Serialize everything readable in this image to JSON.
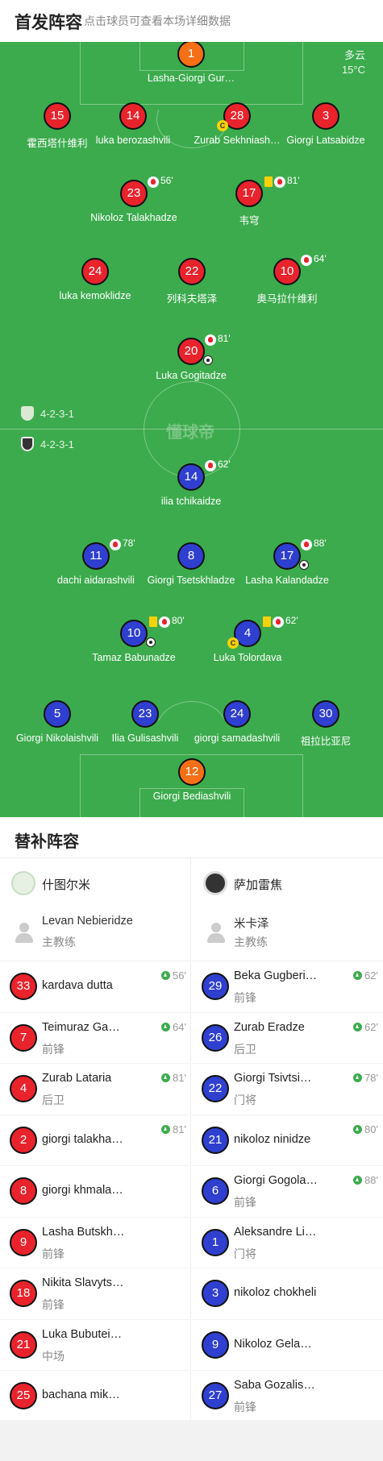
{
  "header": {
    "title": "首发阵容",
    "subtitle": "点击球员可查看本场详细数据"
  },
  "weather": {
    "condition": "多云",
    "temp": "15°C"
  },
  "watermark": "懂球帝",
  "home_formation": "4-2-3-1",
  "away_formation": "4-2-3-1",
  "home": [
    {
      "num": "1",
      "name": "Lasha-Giorgi Gur…",
      "color": "orange"
    },
    {
      "num": "15",
      "name": "霍西塔什维利"
    },
    {
      "num": "14",
      "name": "luka berozashvili"
    },
    {
      "num": "28",
      "name": "Zurab Sekhniash…",
      "captain": "C"
    },
    {
      "num": "3",
      "name": "Giorgi Latsabidze"
    },
    {
      "num": "23",
      "name": "Nikoloz Talakhadze",
      "sub": "56'"
    },
    {
      "num": "17",
      "name": "韦穹",
      "sub": "81'",
      "yellow": true
    },
    {
      "num": "24",
      "name": "luka kemoklidze"
    },
    {
      "num": "22",
      "name": "列科夫塔泽"
    },
    {
      "num": "10",
      "name": "奥马拉什维利",
      "sub": "64'"
    },
    {
      "num": "20",
      "name": "Luka Gogitadze",
      "sub": "81'",
      "goal": true
    }
  ],
  "away": [
    {
      "num": "14",
      "name": "ilia tchikaidze",
      "sub": "62'"
    },
    {
      "num": "11",
      "name": "dachi aidarashvili",
      "sub": "78'"
    },
    {
      "num": "8",
      "name": "Giorgi Tsetskhladze"
    },
    {
      "num": "17",
      "name": "Lasha Kalandadze",
      "sub": "88'",
      "goal": true
    },
    {
      "num": "10",
      "name": "Tamaz Babunadze",
      "sub": "80'",
      "yellow": true,
      "goal": true
    },
    {
      "num": "4",
      "name": "Luka Tolordava",
      "sub": "62'",
      "yellow": true,
      "captain": "C"
    },
    {
      "num": "5",
      "name": "Giorgi Nikolaishvili"
    },
    {
      "num": "23",
      "name": "Ilia Gulisashvili"
    },
    {
      "num": "24",
      "name": "giorgi samadashvili"
    },
    {
      "num": "30",
      "name": "祖拉比亚尼"
    },
    {
      "num": "12",
      "name": "Giorgi Bediashvili",
      "color": "orange"
    }
  ],
  "subs": {
    "title": "替补阵容",
    "home_team": "什图尔米",
    "away_team": "萨加雷焦",
    "home_coach": {
      "name": "Levan Nebieridze",
      "role": "主教练"
    },
    "away_coach": {
      "name": "米卡泽",
      "role": "主教练"
    },
    "home_list": [
      {
        "num": "33",
        "name": "kardava dutta",
        "pos": "",
        "in": "56'"
      },
      {
        "num": "7",
        "name": "Teimuraz Ga…",
        "pos": "前锋",
        "in": "64'"
      },
      {
        "num": "4",
        "name": "Zurab Lataria",
        "pos": "后卫",
        "in": "81'"
      },
      {
        "num": "2",
        "name": "giorgi talakha…",
        "pos": "",
        "in": "81'"
      },
      {
        "num": "8",
        "name": "giorgi khmala…",
        "pos": "",
        "in": ""
      },
      {
        "num": "9",
        "name": "Lasha Butskh…",
        "pos": "前锋",
        "in": ""
      },
      {
        "num": "18",
        "name": "Nikita Slavyts…",
        "pos": "前锋",
        "in": ""
      },
      {
        "num": "21",
        "name": "Luka Bubutei…",
        "pos": "中场",
        "in": ""
      },
      {
        "num": "25",
        "name": "bachana mik…",
        "pos": "",
        "in": ""
      }
    ],
    "away_list": [
      {
        "num": "29",
        "name": "Beka Gugberi…",
        "pos": "前锋",
        "in": "62'"
      },
      {
        "num": "26",
        "name": "Zurab Eradze",
        "pos": "后卫",
        "in": "62'"
      },
      {
        "num": "22",
        "name": "Giorgi Tsivtsi…",
        "pos": "门将",
        "in": "78'"
      },
      {
        "num": "21",
        "name": "nikoloz ninidze",
        "pos": "",
        "in": "80'"
      },
      {
        "num": "6",
        "name": "Giorgi Gogola…",
        "pos": "前锋",
        "in": "88'"
      },
      {
        "num": "1",
        "name": "Aleksandre Li…",
        "pos": "门将",
        "in": ""
      },
      {
        "num": "3",
        "name": "nikoloz chokheli",
        "pos": "",
        "in": ""
      },
      {
        "num": "9",
        "name": "Nikoloz Gela…",
        "pos": "",
        "in": ""
      },
      {
        "num": "27",
        "name": "Saba Gozalis…",
        "pos": "前锋",
        "in": ""
      }
    ]
  }
}
